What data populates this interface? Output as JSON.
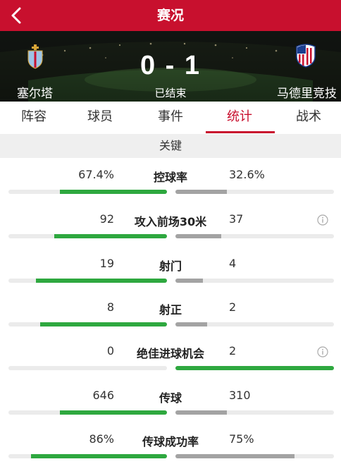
{
  "header": {
    "title": "赛况",
    "back_icon": "chevron-left-icon"
  },
  "match": {
    "home_team": "塞尔塔",
    "away_team": "马德里竞技",
    "score": "0 - 1",
    "status": "已结束",
    "home_logo_icon": "celta-crest-icon",
    "away_logo_icon": "atletico-crest-icon"
  },
  "tabs": [
    {
      "label": "阵容",
      "active": false
    },
    {
      "label": "球员",
      "active": false
    },
    {
      "label": "事件",
      "active": false
    },
    {
      "label": "统计",
      "active": true
    },
    {
      "label": "战术",
      "active": false
    }
  ],
  "section_title": "关键",
  "colors": {
    "brand": "#c8102e",
    "leader_bar": "#2ea83f",
    "other_bar": "#a3a3a3",
    "track": "#ebebeb"
  },
  "stats": [
    {
      "label": "控球率",
      "home": "67.4%",
      "away": "32.6%",
      "home_share": 0.674,
      "away_share": 0.326,
      "leader": "home",
      "info": false
    },
    {
      "label": "攻入前场30米",
      "home": "92",
      "away": "37",
      "home_share": 0.713,
      "away_share": 0.287,
      "leader": "home",
      "info": true
    },
    {
      "label": "射门",
      "home": "19",
      "away": "4",
      "home_share": 0.826,
      "away_share": 0.174,
      "leader": "home",
      "info": false
    },
    {
      "label": "射正",
      "home": "8",
      "away": "2",
      "home_share": 0.8,
      "away_share": 0.2,
      "leader": "home",
      "info": false
    },
    {
      "label": "绝佳进球机会",
      "home": "0",
      "away": "2",
      "home_share": 0.0,
      "away_share": 1.0,
      "leader": "away",
      "info": true
    },
    {
      "label": "传球",
      "home": "646",
      "away": "310",
      "home_share": 0.676,
      "away_share": 0.324,
      "leader": "home",
      "info": false
    },
    {
      "label": "传球成功率",
      "home": "86%",
      "away": "75%",
      "home_share": 0.86,
      "away_share": 0.75,
      "leader": "home",
      "info": false
    }
  ]
}
